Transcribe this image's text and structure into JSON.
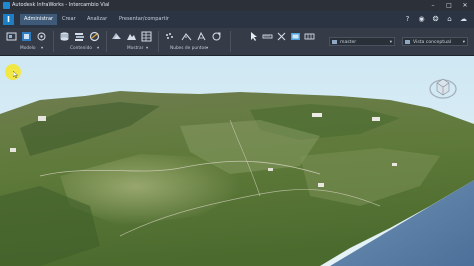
{
  "window": {
    "title": "Autodesk InfraWorks - Intercambio Vial",
    "controls": [
      "minimize-icon",
      "maximize-icon",
      "close-icon"
    ]
  },
  "ribbon": {
    "app_button_label": "I",
    "tabs": [
      {
        "label": "Administrar",
        "active": true
      },
      {
        "label": "Crear",
        "active": false
      },
      {
        "label": "Analizar",
        "active": false
      },
      {
        "label": "Presentar/compartir",
        "active": false
      }
    ],
    "quick_icons": [
      "help-icon",
      "user-icon",
      "settings-icon",
      "notifications-icon",
      "cloud-icon"
    ],
    "groups": {
      "modelo": "Modelo",
      "contenido": "Contenido",
      "mostrar": "Mostrar",
      "nubes": "Nubes de puntos"
    },
    "proposal_select": "master",
    "visual_style_select": "Vista conceptual"
  },
  "viewport": {
    "sky_top": "#cfe8f3",
    "sky_bottom": "#e6f2f6",
    "terrain_dark": "#3c5a2a",
    "terrain_light": "#95a86a",
    "water": "#5b7fa6",
    "cursor_highlight": "#f7e526"
  }
}
